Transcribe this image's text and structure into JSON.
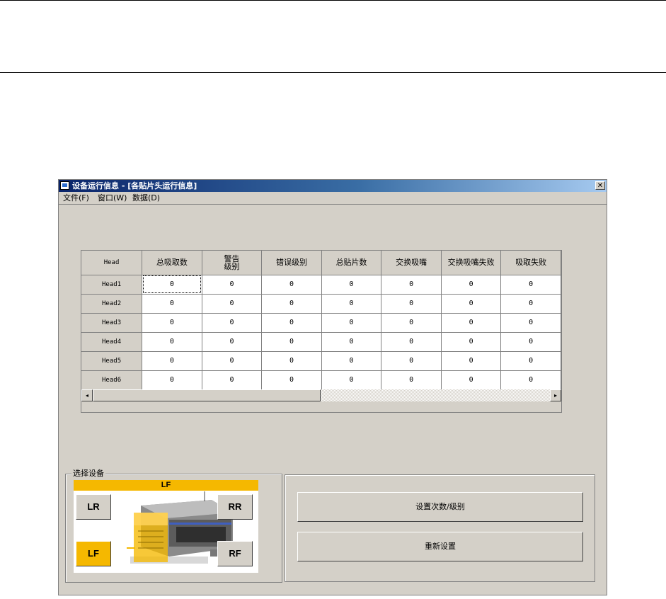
{
  "window": {
    "title": "设备运行信息 - [各贴片头运行信息]",
    "close_glyph": "✕"
  },
  "menu": [
    {
      "label": "文件(F)"
    },
    {
      "label": "窗口(W)"
    },
    {
      "label": "数据(D)"
    }
  ],
  "table": {
    "columns": [
      "Head",
      "总吸取数",
      "警告级别",
      "错误级别",
      "总贴片数",
      "交换吸嘴",
      "交换吸嘴失败",
      "吸取失败"
    ],
    "rows": [
      {
        "head": "Head1",
        "values": [
          "0",
          "0",
          "0",
          "0",
          "0",
          "0",
          "0"
        ]
      },
      {
        "head": "Head2",
        "values": [
          "0",
          "0",
          "0",
          "0",
          "0",
          "0",
          "0"
        ]
      },
      {
        "head": "Head3",
        "values": [
          "0",
          "0",
          "0",
          "0",
          "0",
          "0",
          "0"
        ]
      },
      {
        "head": "Head4",
        "values": [
          "0",
          "0",
          "0",
          "0",
          "0",
          "0",
          "0"
        ]
      },
      {
        "head": "Head5",
        "values": [
          "0",
          "0",
          "0",
          "0",
          "0",
          "0",
          "0"
        ]
      },
      {
        "head": "Head6",
        "values": [
          "0",
          "0",
          "0",
          "0",
          "0",
          "0",
          "0"
        ]
      }
    ]
  },
  "scrollbar": {
    "left_arrow": "◂",
    "right_arrow": "▸"
  },
  "device_select": {
    "group_label": "选择设备",
    "selected": "LF",
    "buttons": {
      "lr": "LR",
      "rr": "RR",
      "lf": "LF",
      "rf": "RF"
    },
    "highlight_color": "#f5b800"
  },
  "actions": {
    "set_counts": "设置次数/级别",
    "reset": "重新设置"
  }
}
